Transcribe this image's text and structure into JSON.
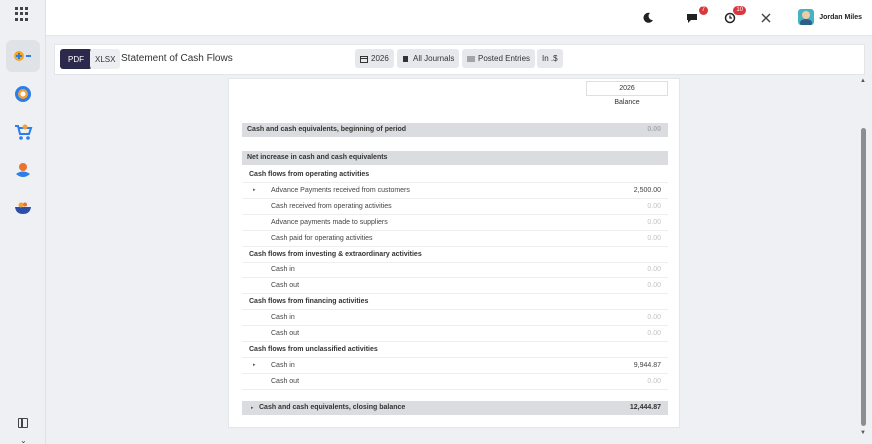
{
  "topbar": {
    "chat_badge": "7",
    "activity_badge": "10",
    "user_name": "Jordan Miles"
  },
  "sidebar": {
    "items": [
      {
        "icon": "accounting-icon",
        "active": true
      },
      {
        "icon": "ai-icon",
        "active": false
      },
      {
        "icon": "shopping-cart-icon",
        "active": false
      },
      {
        "icon": "person-pin-icon",
        "active": false
      },
      {
        "icon": "bowl-icon",
        "active": false
      }
    ]
  },
  "control": {
    "pdf_label": "PDF",
    "xlsx_label": "XLSX",
    "title": "Statement of Cash Flows",
    "filters": {
      "date": "2026",
      "journals": "All Journals",
      "entries": "Posted Entries",
      "currency": "In .$"
    }
  },
  "report": {
    "column_year": "2026",
    "column_label": "Balance",
    "rows": [
      {
        "type": "section",
        "label": "Cash and cash equivalents, beginning of period",
        "value": "0.00",
        "zero": true
      },
      {
        "type": "section",
        "label": "Net increase in cash and cash equivalents",
        "value": "",
        "zero": false
      },
      {
        "type": "group",
        "label": "Cash flows from operating activities",
        "value": "",
        "zero": false
      },
      {
        "type": "line",
        "label": "Advance Payments received from customers",
        "value": "2,500.00",
        "zero": false,
        "caret": true
      },
      {
        "type": "line",
        "label": "Cash received from operating activities",
        "value": "0.00",
        "zero": true
      },
      {
        "type": "line",
        "label": "Advance payments made to suppliers",
        "value": "0.00",
        "zero": true
      },
      {
        "type": "line",
        "label": "Cash paid for operating activities",
        "value": "0.00",
        "zero": true
      },
      {
        "type": "group",
        "label": "Cash flows from investing & extraordinary activities",
        "value": "",
        "zero": false
      },
      {
        "type": "line",
        "label": "Cash in",
        "value": "0.00",
        "zero": true
      },
      {
        "type": "line",
        "label": "Cash out",
        "value": "0.00",
        "zero": true
      },
      {
        "type": "group",
        "label": "Cash flows from financing activities",
        "value": "",
        "zero": false
      },
      {
        "type": "line",
        "label": "Cash in",
        "value": "0.00",
        "zero": true
      },
      {
        "type": "line",
        "label": "Cash out",
        "value": "0.00",
        "zero": true
      },
      {
        "type": "group",
        "label": "Cash flows from unclassified activities",
        "value": "",
        "zero": false
      },
      {
        "type": "line",
        "label": "Cash in",
        "value": "9,944.87",
        "zero": false,
        "caret": true
      },
      {
        "type": "line",
        "label": "Cash out",
        "value": "0.00",
        "zero": true
      },
      {
        "type": "section",
        "label": "Cash and cash equivalents, closing balance",
        "value": "12,444.87",
        "zero": false,
        "caret": true
      }
    ]
  }
}
